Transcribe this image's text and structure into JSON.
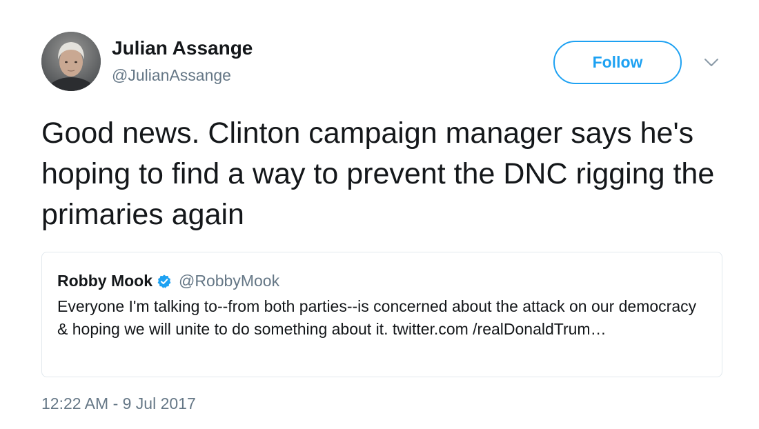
{
  "author": {
    "name": "Julian Assange",
    "handle": "@JulianAssange"
  },
  "actions": {
    "follow_label": "Follow",
    "more_icon": "chevron-down-icon"
  },
  "tweet": {
    "text": "Good news. Clinton campaign manager says he's hoping to find a way to prevent the DNC rigging the primaries again",
    "timestamp": "12:22 AM - 9 Jul 2017"
  },
  "quoted_tweet": {
    "name": "Robby Mook",
    "verified_icon": "verified-badge-icon",
    "handle": "@RobbyMook",
    "text": "Everyone I'm talking to--from both parties--is concerned about the attack on our democracy & hoping we will unite to do something about it. twitter.com /realDonaldTrum…"
  },
  "colors": {
    "accent": "#1da1f2",
    "text_primary": "#14171a",
    "text_secondary": "#657786",
    "border": "#e1e8ed"
  }
}
